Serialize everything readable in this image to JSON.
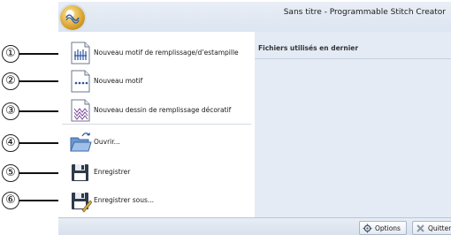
{
  "callouts": [
    "①",
    "②",
    "③",
    "④",
    "⑤",
    "⑥"
  ],
  "window": {
    "title": "Sans titre - Programmable Stitch Creator"
  },
  "menu": {
    "items": [
      {
        "label": "Nouveau motif de remplissage/d’estampille",
        "icon": "new-fill-stamp-pattern-icon"
      },
      {
        "label": "Nouveau motif",
        "icon": "new-motif-icon"
      },
      {
        "label": "Nouveau dessin de remplissage décoratif",
        "icon": "new-decorative-fill-icon"
      },
      {
        "label": "Ouvrir...",
        "icon": "open-folder-icon"
      },
      {
        "label": "Enregistrer",
        "icon": "save-icon"
      },
      {
        "label": "Enregistrer sous...",
        "icon": "save-as-icon"
      }
    ]
  },
  "recent": {
    "title": "Fichiers utilisés en dernier"
  },
  "footer": {
    "options_label": "Options",
    "quit_label": "Quitter"
  }
}
